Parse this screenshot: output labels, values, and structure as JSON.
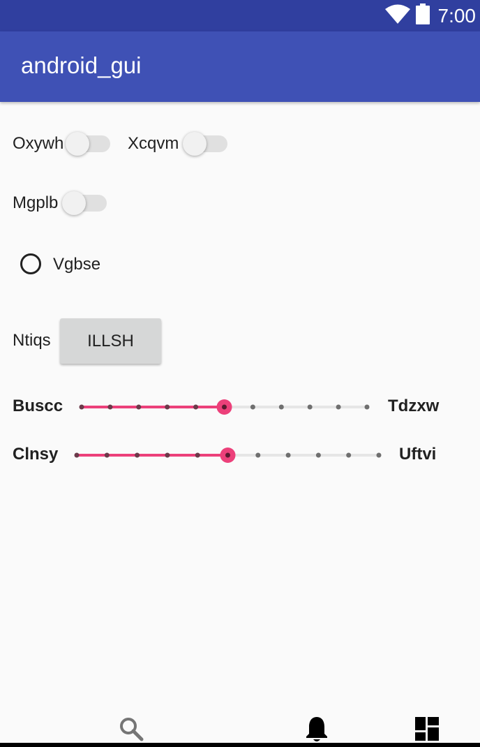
{
  "status_bar": {
    "time": "7:00",
    "icons": [
      "wifi-icon",
      "battery-icon"
    ]
  },
  "app_bar": {
    "title": "android_gui",
    "color": "#3f51b5"
  },
  "switches": [
    {
      "label": "Oxywh",
      "checked": false
    },
    {
      "label": "Xcqvm",
      "checked": false
    },
    {
      "label": "Mgplb",
      "checked": false
    }
  ],
  "radio": {
    "label": "Vgbse",
    "checked": false
  },
  "button_row": {
    "label": "Ntiqs",
    "button_label": "ILLSH"
  },
  "sliders": [
    {
      "label": "Buscc",
      "end_label": "Tdzxw",
      "steps": 10,
      "value": 5
    },
    {
      "label": "Clnsy",
      "end_label": "Uftvi",
      "steps": 10,
      "value": 5
    }
  ],
  "accent_color": "#ec407a",
  "bottom_nav": {
    "icons": [
      "search-icon",
      "bell-icon",
      "dashboard-icon"
    ]
  }
}
